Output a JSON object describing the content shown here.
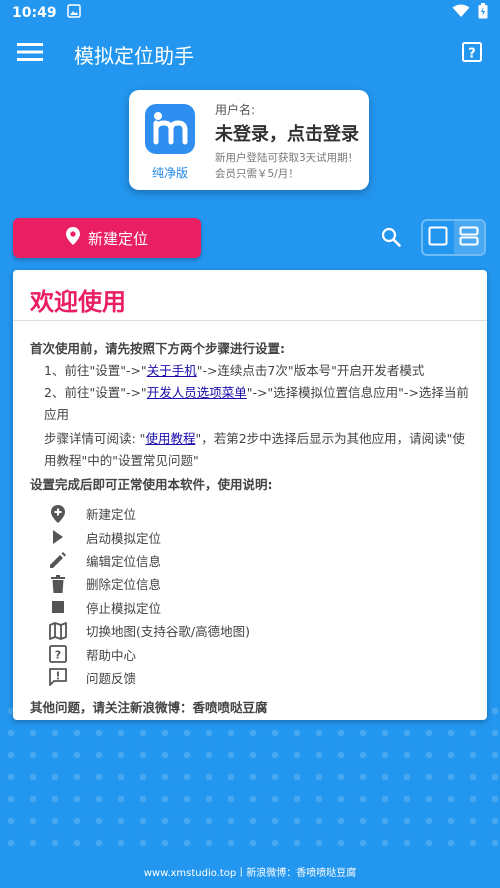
{
  "status_bar": {
    "time": "10:49"
  },
  "app_bar": {
    "title": "模拟定位助手",
    "menu_icon": "hamburger-menu-icon",
    "help_icon": "help-question-icon"
  },
  "login_card": {
    "logo_caption": "纯净版",
    "user_label": "用户名:",
    "title": "未登录，点击登录",
    "note": "新用户登陆可获取3天试用期！会员只需￥5/月！"
  },
  "toolbar": {
    "new_location": "新建定位"
  },
  "welcome": {
    "title": "欢迎使用",
    "intro": "首次使用前，请先按照下方两个步骤进行设置:",
    "step1": {
      "a": "1、前往\"设置\"->\"",
      "link": "关于手机",
      "b": "\"->连续点击7次\"版本号\"开启开发者模式"
    },
    "step2": {
      "a": "2、前往\"设置\"->\"",
      "link": "开发人员选项菜单",
      "b": "\"->\"选择模拟位置信息应用\"->选择当前应用"
    },
    "tip": {
      "a": "步骤详情可阅读: \"",
      "link": "使用教程",
      "b": "\"，若第2步中选择后显示为其他应用，请阅读\"使用教程\"中的\"设置常见问题\""
    },
    "usage_intro": "设置完成后即可正常使用本软件，使用说明:",
    "usage": [
      {
        "icon": "add-location-icon",
        "text": "新建定位"
      },
      {
        "icon": "play-icon",
        "text": "启动模拟定位"
      },
      {
        "icon": "edit-pencil-icon",
        "text": "编辑定位信息"
      },
      {
        "icon": "delete-trash-icon",
        "text": "删除定位信息"
      },
      {
        "icon": "stop-icon",
        "text": "停止模拟定位"
      },
      {
        "icon": "map-icon",
        "text": "切换地图(支持谷歌/高德地图)"
      },
      {
        "icon": "help-question-icon",
        "text": "帮助中心"
      },
      {
        "icon": "feedback-icon",
        "text": "问题反馈"
      }
    ],
    "other": "其他问题，请关注新浪微博：香喷喷哒豆腐"
  },
  "footer": {
    "text": "www.xmstudio.top丨新浪微博：香喷喷哒豆腐"
  },
  "colors": {
    "primary": "#2396ef",
    "accent": "#e91e63",
    "link": "#1a0dab"
  }
}
